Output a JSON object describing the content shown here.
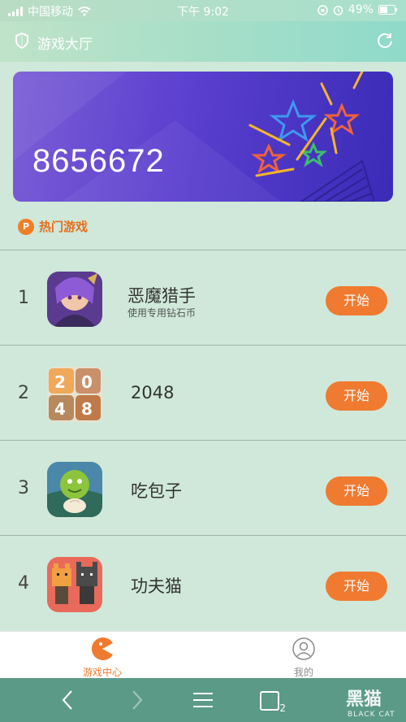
{
  "status_bar": {
    "carrier": "中国移动",
    "time": "下午 9:02",
    "battery": "49%"
  },
  "header": {
    "title": "游戏大厅",
    "shield_icon": "shield-icon",
    "refresh_icon": "refresh-icon"
  },
  "banner": {
    "number": "8656672"
  },
  "hot_games": {
    "badge": "P",
    "label": "热门游戏"
  },
  "games": [
    {
      "rank": "1",
      "name": "恶魔猎手",
      "subtitle": "使用专用钻石币",
      "button": "开始"
    },
    {
      "rank": "2",
      "name": "2048",
      "subtitle": "",
      "button": "开始"
    },
    {
      "rank": "3",
      "name": "吃包子",
      "subtitle": "",
      "button": "开始"
    },
    {
      "rank": "4",
      "name": "功夫猫",
      "subtitle": "",
      "button": "开始"
    }
  ],
  "tabs": {
    "game_center": "游戏中心",
    "mine": "我的"
  },
  "browser_nav": {
    "tab_count": "2",
    "watermark_cn": "黑猫",
    "watermark_en": "BLACK CAT"
  },
  "colors": {
    "accent": "#f07a30",
    "banner_start": "#7a5ed6",
    "banner_end": "#3a2bb7",
    "background": "#cfe8d9"
  }
}
